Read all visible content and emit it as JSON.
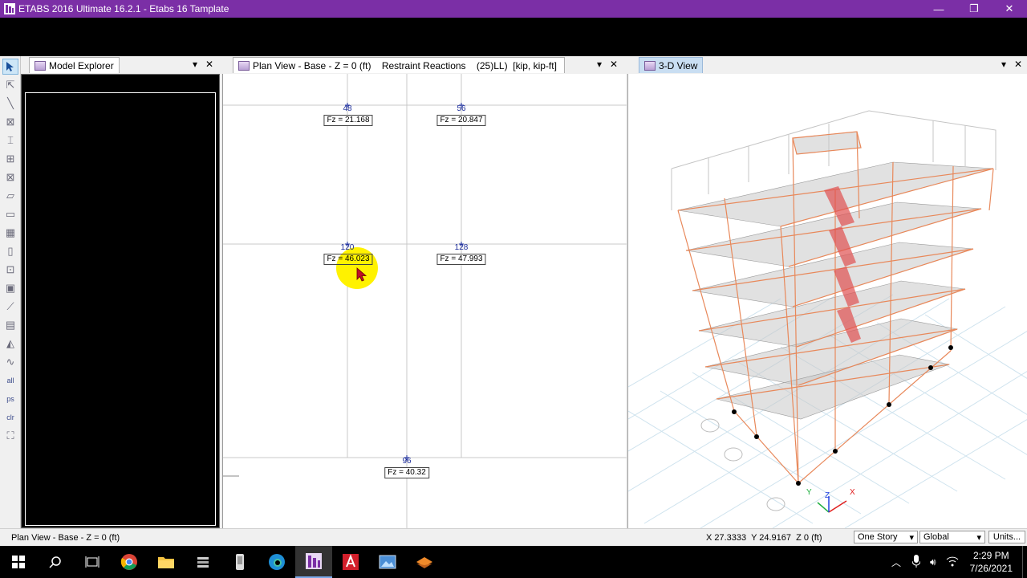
{
  "window": {
    "title": "ETABS 2016 Ultimate 16.2.1 - Etabs 16 Tamplate",
    "minimize": "—",
    "restore": "❐",
    "close": "✕"
  },
  "panels": {
    "explorer": {
      "label": "Model Explorer",
      "dropdown": "▾",
      "close": "✕"
    },
    "plan": {
      "label": "Plan View - Base - Z = 0 (ft)    Restraint Reactions    (25)LL)  [kip, kip-ft]",
      "dropdown": "▾",
      "close": "✕"
    },
    "view3d": {
      "label": "3-D View",
      "dropdown": "▾",
      "close": "✕"
    }
  },
  "plan_view": {
    "nodes": [
      {
        "id": "48",
        "reaction": "Fz = 21.168"
      },
      {
        "id": "56",
        "reaction": "Fz = 20.847"
      },
      {
        "id": "120",
        "reaction": "Fz = 46.023"
      },
      {
        "id": "128",
        "reaction": "Fz = 47.993"
      },
      {
        "id": "96",
        "reaction": "Fz = 40.32"
      }
    ]
  },
  "axes": {
    "x": "X",
    "y": "Y",
    "z": "Z"
  },
  "tools": {
    "all_label": "all",
    "ps_label": "ps",
    "clr_label": "clr"
  },
  "status": {
    "left": "Plan View - Base - Z = 0 (ft)",
    "coords": "X 27.3333  Y 24.9167  Z 0 (ft)",
    "story_select": "One Story",
    "coord_system": "Global",
    "units_button": "Units..."
  },
  "taskbar": {
    "time": "2:29 PM",
    "date": "7/26/2021"
  },
  "colors": {
    "titlebar": "#7b2fa6",
    "frame_orange": "#e8885a",
    "slab_gray": "#c8c8c8",
    "brace_red": "#e05050",
    "cursor_highlight": "#fff200"
  }
}
